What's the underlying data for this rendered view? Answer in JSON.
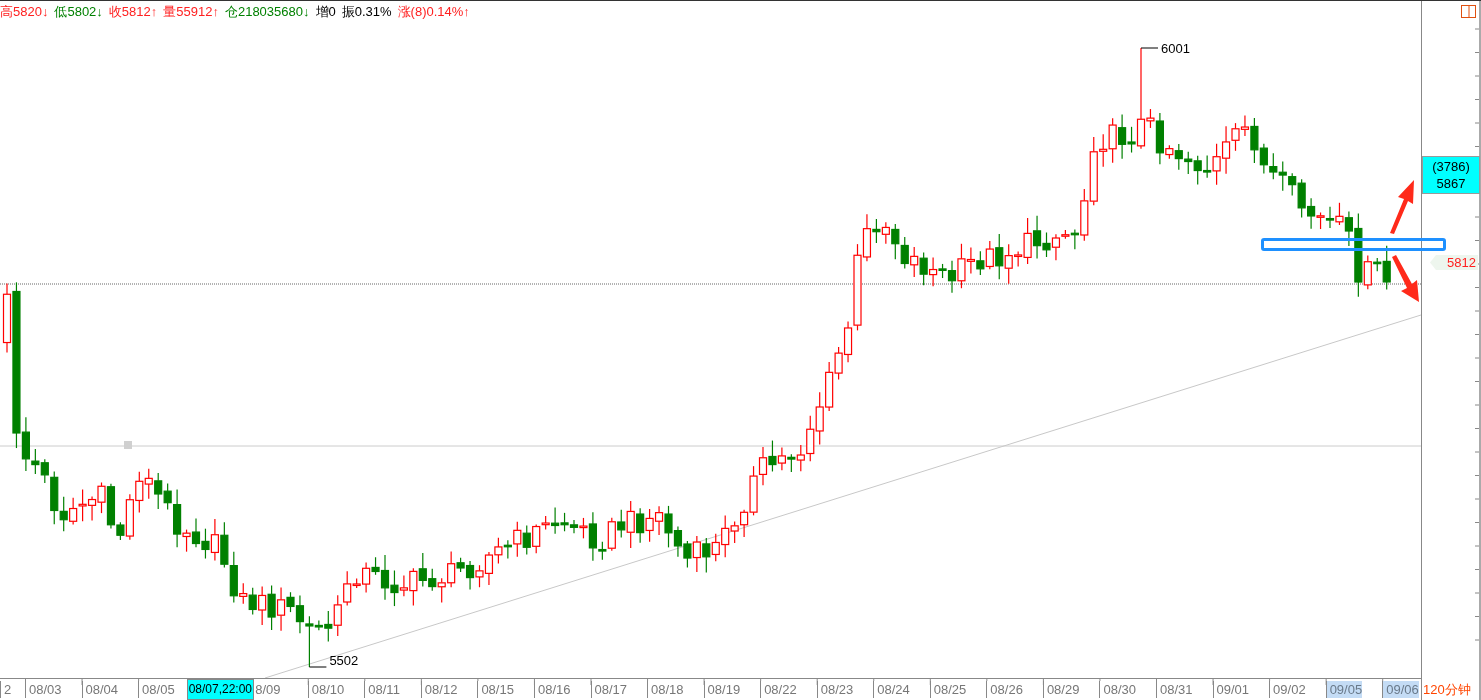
{
  "stats": [
    {
      "text": "高5820↓",
      "color": "#ff2020"
    },
    {
      "text": "低5802↓",
      "color": "#008000"
    },
    {
      "text": "收5812↑",
      "color": "#ff2020"
    },
    {
      "text": "量55912↑",
      "color": "#ff2020"
    },
    {
      "text": "仓218035680↓",
      "color": "#008000"
    },
    {
      "text": "增0",
      "color": "#000000"
    },
    {
      "text": "振0.31%",
      "color": "#000000"
    },
    {
      "text": "涨(8)0.14%↑",
      "color": "#ff2020"
    }
  ],
  "chart": {
    "high_label": "6001",
    "low_label": "5502",
    "last_price": "5812",
    "cursor_volume": "(3786)",
    "cursor_price": "5867"
  },
  "period": "120分钟",
  "x_axis": [
    {
      "label": "2",
      "kind": "date",
      "highlighted": false
    },
    {
      "label": "08/03",
      "kind": "date",
      "highlighted": false
    },
    {
      "label": "08/04",
      "kind": "date",
      "highlighted": false
    },
    {
      "label": "08/05",
      "kind": "date",
      "highlighted": false
    },
    {
      "label": "08/07,22:00",
      "kind": "cursor"
    },
    {
      "label": "8/09",
      "kind": "date",
      "highlighted": false
    },
    {
      "label": "08/10",
      "kind": "date",
      "highlighted": false
    },
    {
      "label": "08/11",
      "kind": "date",
      "highlighted": false
    },
    {
      "label": "08/12",
      "kind": "date",
      "highlighted": false
    },
    {
      "label": "08/15",
      "kind": "date",
      "highlighted": false
    },
    {
      "label": "08/16",
      "kind": "date",
      "highlighted": false
    },
    {
      "label": "08/17",
      "kind": "date",
      "highlighted": false
    },
    {
      "label": "08/18",
      "kind": "date",
      "highlighted": false
    },
    {
      "label": "08/19",
      "kind": "date",
      "highlighted": false
    },
    {
      "label": "08/22",
      "kind": "date",
      "highlighted": false
    },
    {
      "label": "08/23",
      "kind": "date",
      "highlighted": false
    },
    {
      "label": "08/24",
      "kind": "date",
      "highlighted": false
    },
    {
      "label": "08/25",
      "kind": "date",
      "highlighted": false
    },
    {
      "label": "08/26",
      "kind": "date",
      "highlighted": false
    },
    {
      "label": "08/29",
      "kind": "date",
      "highlighted": false
    },
    {
      "label": "08/30",
      "kind": "date",
      "highlighted": false
    },
    {
      "label": "08/31",
      "kind": "date",
      "highlighted": false
    },
    {
      "label": "09/01",
      "kind": "date",
      "highlighted": false
    },
    {
      "label": "09/02",
      "kind": "date",
      "highlighted": false
    },
    {
      "label": "09/05",
      "kind": "date",
      "highlighted": true
    },
    {
      "label": "09/06",
      "kind": "date",
      "highlighted": true
    }
  ]
}
